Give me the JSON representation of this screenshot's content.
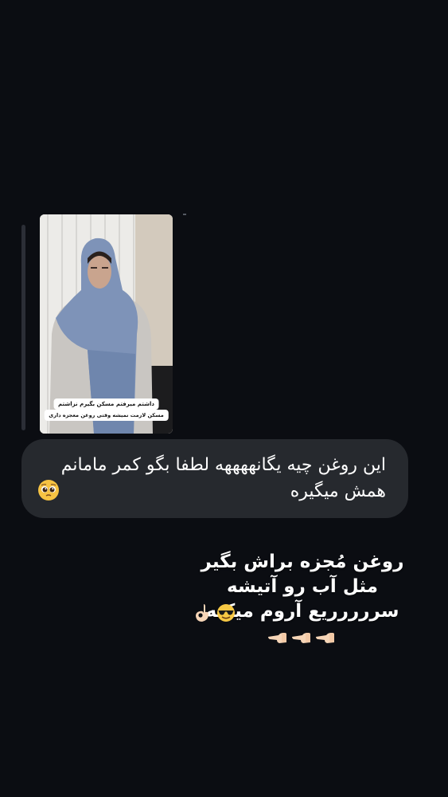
{
  "story": {
    "caption_line1": "داشتم میرفتم مسکن بگیرم نزاشتم",
    "caption_line2": "مسکن لازمت نمیشه وقتی روغن معجزه داری"
  },
  "message": {
    "text": "این روغن چیه یگانههههه لطفا بگو کمر مامانم همش میگیره",
    "emoji": "pleading-face-icon"
  },
  "reply": {
    "line1": "روغن مُجزه براش بگیر",
    "line2": "مثل آب رو آتیشه",
    "line3": "سررررریع آروم میکنه",
    "emojis": [
      "smiling-face-sunglasses-icon",
      "ok-hand-icon",
      "backhand-point-left-icon"
    ]
  },
  "colors": {
    "background": "#0b0d12",
    "bubble": "#26292e",
    "text": "#ffffff"
  }
}
